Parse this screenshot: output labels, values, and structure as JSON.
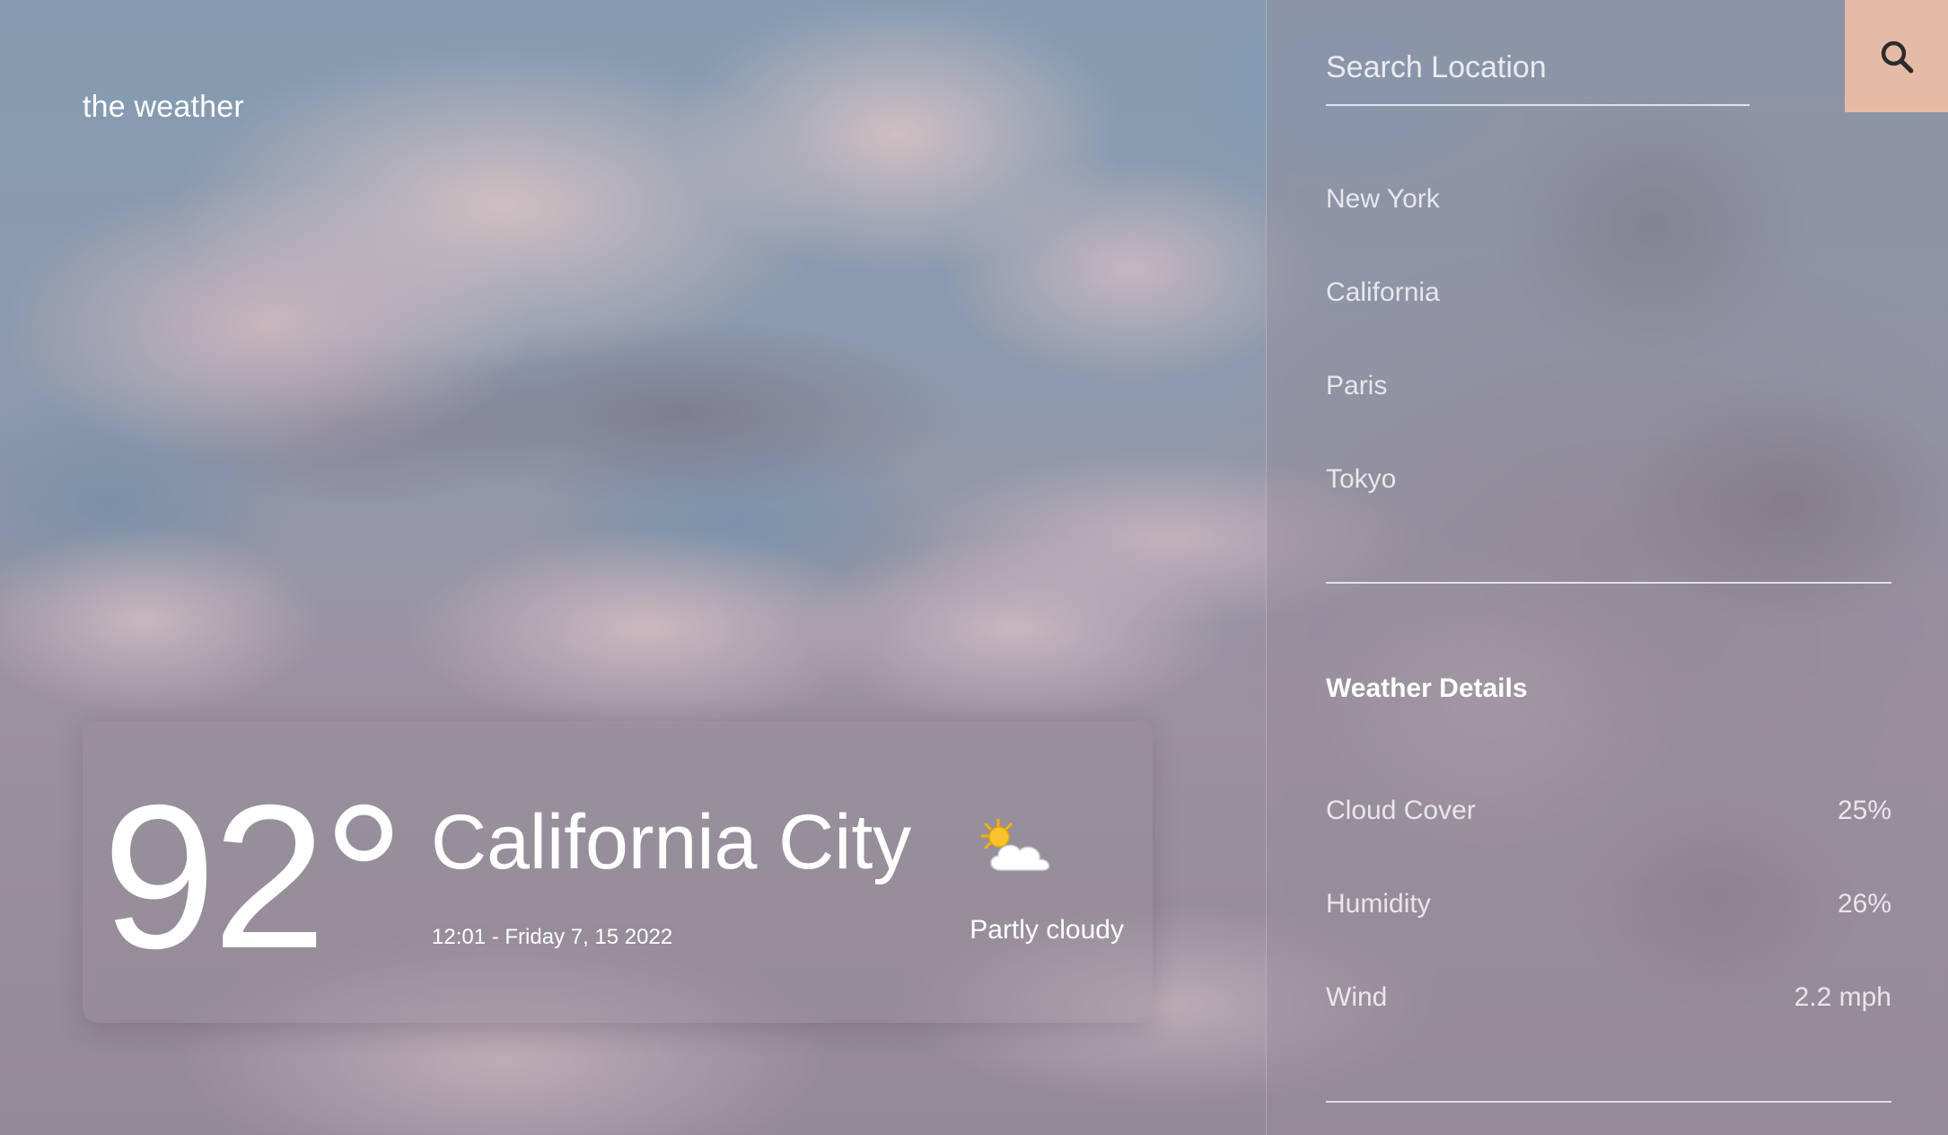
{
  "brand": "the weather",
  "current": {
    "temperature": "92°",
    "city": "California City",
    "datetime": "12:01 - Friday 7, 15 2022",
    "condition": "Partly cloudy",
    "icon": "partly-cloudy-icon"
  },
  "search": {
    "placeholder": "Search Location",
    "value": "",
    "button_icon": "search-icon",
    "button_color": "#e6bba6"
  },
  "locations": [
    "New York",
    "California",
    "Paris",
    "Tokyo"
  ],
  "details": {
    "title": "Weather Details",
    "rows": [
      {
        "label": "Cloud Cover",
        "value": "25%"
      },
      {
        "label": "Humidity",
        "value": "26%"
      },
      {
        "label": "Wind",
        "value": "2.2 mph"
      }
    ]
  }
}
